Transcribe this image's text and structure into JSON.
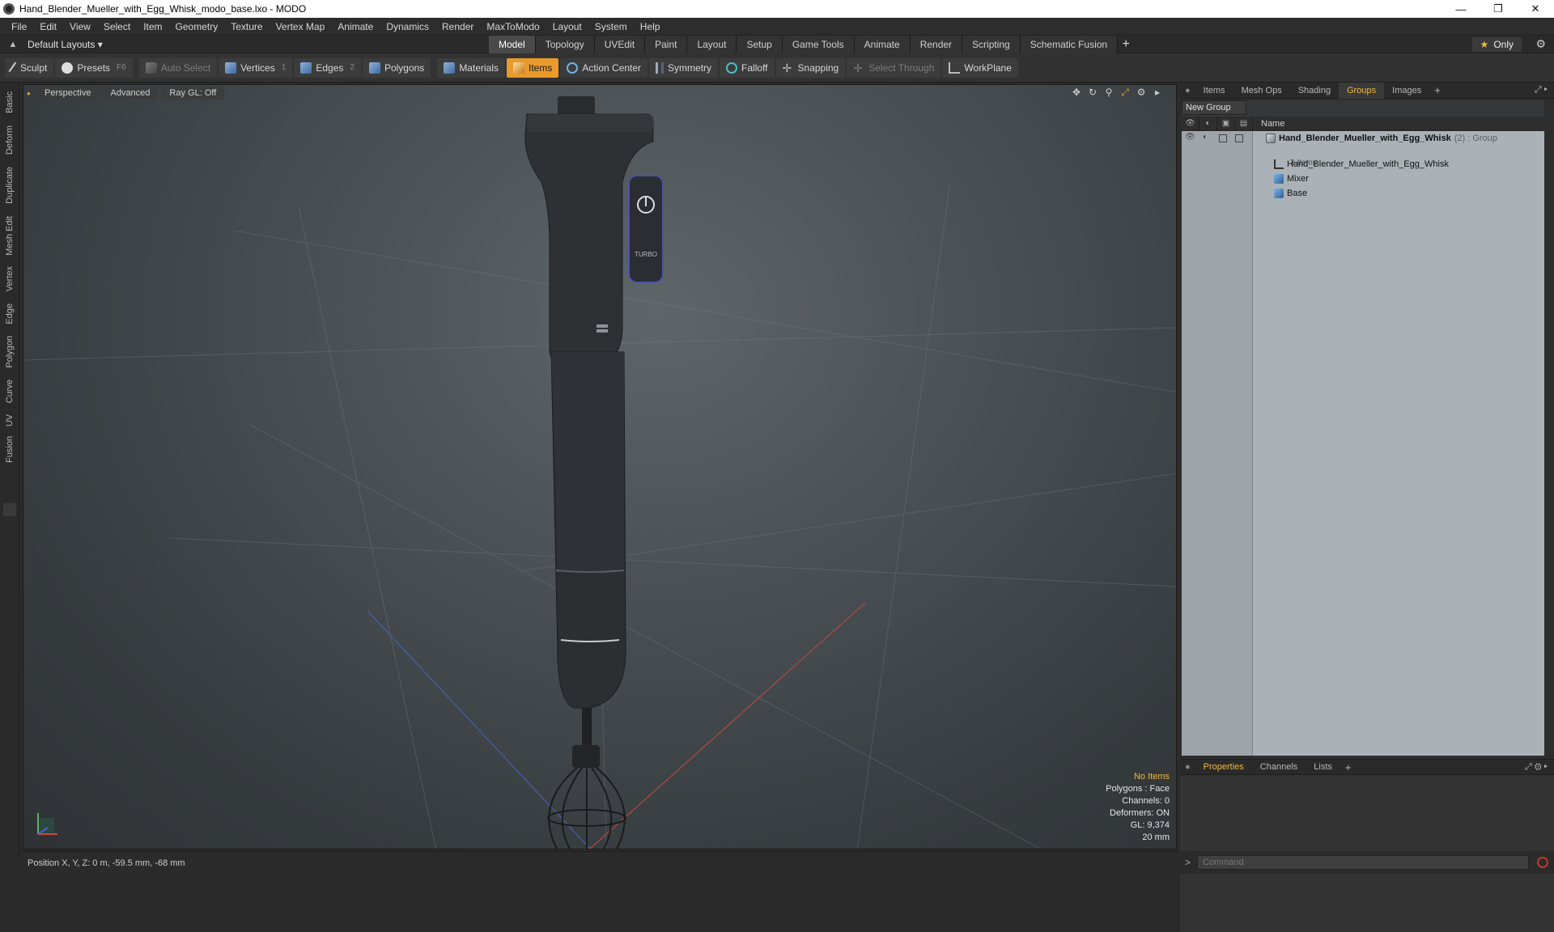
{
  "window": {
    "title": "Hand_Blender_Mueller_with_Egg_Whisk_modo_base.lxo - MODO",
    "minimize": "—",
    "maximize": "❐",
    "close": "✕"
  },
  "menu": [
    "File",
    "Edit",
    "View",
    "Select",
    "Item",
    "Geometry",
    "Texture",
    "Vertex Map",
    "Animate",
    "Dynamics",
    "Render",
    "MaxToModo",
    "Layout",
    "System",
    "Help"
  ],
  "layout_bar": {
    "layout_select": "Default Layouts ▾",
    "tabs": [
      "Model",
      "Topology",
      "UVEdit",
      "Paint",
      "Layout",
      "Setup",
      "Game Tools",
      "Animate",
      "Render",
      "Scripting",
      "Schematic Fusion"
    ],
    "active_tab": "Model",
    "only_label": "Only"
  },
  "toolbar": {
    "sculpt": "Sculpt",
    "presets": "Presets",
    "presets_hint": "F6",
    "auto_select": "Auto Select",
    "vertices": "Vertices",
    "vertices_hint": "1",
    "edges": "Edges",
    "edges_hint": "2",
    "polygons": "Polygons",
    "materials": "Materials",
    "items": "Items",
    "action_center": "Action Center",
    "symmetry": "Symmetry",
    "falloff": "Falloff",
    "snapping": "Snapping",
    "select_through": "Select Through",
    "workplane": "WorkPlane"
  },
  "left_tabs": [
    "Basic",
    "Deform",
    "Duplicate",
    "Mesh Edit",
    "Vertex",
    "Edge",
    "Polygon",
    "Curve",
    "UV",
    "Fusion"
  ],
  "viewport": {
    "view_mode": "Perspective",
    "advanced": "Advanced",
    "raygl": "Ray GL: Off",
    "info": {
      "no_items": "No Items",
      "polygons": "Polygons : Face",
      "channels": "Channels: 0",
      "deformers": "Deformers: ON",
      "gl": "GL: 9,374",
      "scale": "20 mm"
    },
    "button_labels": {
      "turbo": "TURBO"
    }
  },
  "status": {
    "position": "Position X, Y, Z:  0 m, -59.5 mm, -68 mm"
  },
  "right_panel": {
    "tabs": [
      "Items",
      "Mesh Ops",
      "Shading",
      "Groups",
      "Images"
    ],
    "active_tab": "Groups",
    "new_group": "New Group",
    "name_header": "Name",
    "groups": {
      "root": "Hand_Blender_Mueller_with_Egg_Whisk",
      "root_suffix": "(2) : Group",
      "count": "3 Items",
      "children": [
        "Hand_Blender_Mueller_with_Egg_Whisk",
        "Mixer",
        "Base"
      ]
    },
    "props_tabs": [
      "Properties",
      "Channels",
      "Lists"
    ],
    "props_active": "Properties"
  },
  "command": {
    "placeholder": "Command"
  }
}
